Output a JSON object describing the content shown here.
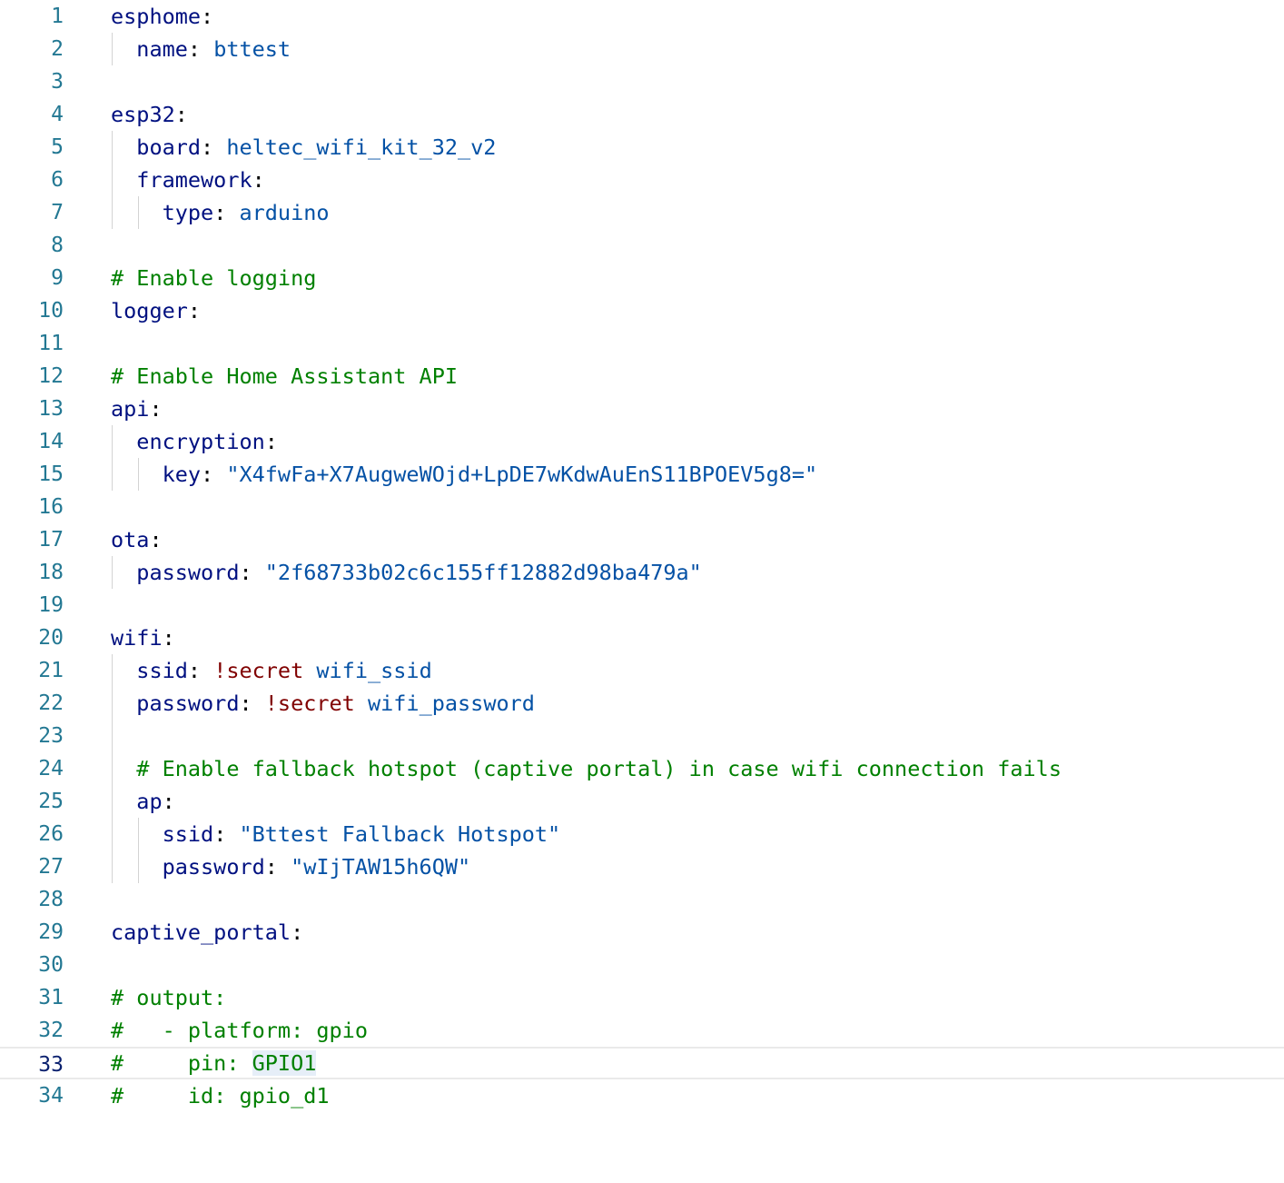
{
  "editor": {
    "current_line": 33,
    "lines": [
      {
        "num": "1",
        "tokens": [
          {
            "t": "esphome",
            "c": "key",
            "n": "yaml-key"
          },
          {
            "t": ":",
            "c": "punct",
            "n": "colon"
          }
        ]
      },
      {
        "num": "2",
        "indent": 1,
        "tokens": [
          {
            "t": "  ",
            "c": "punct",
            "n": "indent"
          },
          {
            "t": "name",
            "c": "key",
            "n": "yaml-key"
          },
          {
            "t": ": ",
            "c": "punct",
            "n": "colon"
          },
          {
            "t": "bttest",
            "c": "val",
            "n": "yaml-value"
          }
        ]
      },
      {
        "num": "3",
        "tokens": []
      },
      {
        "num": "4",
        "tokens": [
          {
            "t": "esp32",
            "c": "key",
            "n": "yaml-key"
          },
          {
            "t": ":",
            "c": "punct",
            "n": "colon"
          }
        ]
      },
      {
        "num": "5",
        "indent": 1,
        "tokens": [
          {
            "t": "  ",
            "c": "punct",
            "n": "indent"
          },
          {
            "t": "board",
            "c": "key",
            "n": "yaml-key"
          },
          {
            "t": ": ",
            "c": "punct",
            "n": "colon"
          },
          {
            "t": "heltec_wifi_kit_32_v2",
            "c": "val",
            "n": "yaml-value"
          }
        ]
      },
      {
        "num": "6",
        "indent": 1,
        "tokens": [
          {
            "t": "  ",
            "c": "punct",
            "n": "indent"
          },
          {
            "t": "framework",
            "c": "key",
            "n": "yaml-key"
          },
          {
            "t": ":",
            "c": "punct",
            "n": "colon"
          }
        ]
      },
      {
        "num": "7",
        "indent": 2,
        "tokens": [
          {
            "t": "    ",
            "c": "punct",
            "n": "indent"
          },
          {
            "t": "type",
            "c": "key",
            "n": "yaml-key"
          },
          {
            "t": ": ",
            "c": "punct",
            "n": "colon"
          },
          {
            "t": "arduino",
            "c": "val",
            "n": "yaml-value"
          }
        ]
      },
      {
        "num": "8",
        "tokens": []
      },
      {
        "num": "9",
        "tokens": [
          {
            "t": "# Enable logging",
            "c": "comment",
            "n": "yaml-comment"
          }
        ]
      },
      {
        "num": "10",
        "tokens": [
          {
            "t": "logger",
            "c": "key",
            "n": "yaml-key"
          },
          {
            "t": ":",
            "c": "punct",
            "n": "colon"
          }
        ]
      },
      {
        "num": "11",
        "tokens": []
      },
      {
        "num": "12",
        "tokens": [
          {
            "t": "# Enable Home Assistant API",
            "c": "comment",
            "n": "yaml-comment"
          }
        ]
      },
      {
        "num": "13",
        "tokens": [
          {
            "t": "api",
            "c": "key",
            "n": "yaml-key"
          },
          {
            "t": ":",
            "c": "punct",
            "n": "colon"
          }
        ]
      },
      {
        "num": "14",
        "indent": 1,
        "tokens": [
          {
            "t": "  ",
            "c": "punct",
            "n": "indent"
          },
          {
            "t": "encryption",
            "c": "key",
            "n": "yaml-key"
          },
          {
            "t": ":",
            "c": "punct",
            "n": "colon"
          }
        ]
      },
      {
        "num": "15",
        "indent": 2,
        "tokens": [
          {
            "t": "    ",
            "c": "punct",
            "n": "indent"
          },
          {
            "t": "key",
            "c": "key",
            "n": "yaml-key"
          },
          {
            "t": ": ",
            "c": "punct",
            "n": "colon"
          },
          {
            "t": "\"X4fwFa+X7AugweWOjd+LpDE7wKdwAuEnS11BPOEV5g8=\"",
            "c": "val",
            "n": "yaml-string"
          }
        ]
      },
      {
        "num": "16",
        "tokens": []
      },
      {
        "num": "17",
        "tokens": [
          {
            "t": "ota",
            "c": "key",
            "n": "yaml-key"
          },
          {
            "t": ":",
            "c": "punct",
            "n": "colon"
          }
        ]
      },
      {
        "num": "18",
        "indent": 1,
        "tokens": [
          {
            "t": "  ",
            "c": "punct",
            "n": "indent"
          },
          {
            "t": "password",
            "c": "key",
            "n": "yaml-key"
          },
          {
            "t": ": ",
            "c": "punct",
            "n": "colon"
          },
          {
            "t": "\"2f68733b02c6c155ff12882d98ba479a\"",
            "c": "val",
            "n": "yaml-string"
          }
        ]
      },
      {
        "num": "19",
        "tokens": []
      },
      {
        "num": "20",
        "tokens": [
          {
            "t": "wifi",
            "c": "key",
            "n": "yaml-key"
          },
          {
            "t": ":",
            "c": "punct",
            "n": "colon"
          }
        ]
      },
      {
        "num": "21",
        "indent": 1,
        "tokens": [
          {
            "t": "  ",
            "c": "punct",
            "n": "indent"
          },
          {
            "t": "ssid",
            "c": "key",
            "n": "yaml-key"
          },
          {
            "t": ": ",
            "c": "punct",
            "n": "colon"
          },
          {
            "t": "!secret",
            "c": "tag",
            "n": "yaml-tag"
          },
          {
            "t": " ",
            "c": "punct",
            "n": "space"
          },
          {
            "t": "wifi_ssid",
            "c": "val",
            "n": "yaml-value"
          }
        ]
      },
      {
        "num": "22",
        "indent": 1,
        "tokens": [
          {
            "t": "  ",
            "c": "punct",
            "n": "indent"
          },
          {
            "t": "password",
            "c": "key",
            "n": "yaml-key"
          },
          {
            "t": ": ",
            "c": "punct",
            "n": "colon"
          },
          {
            "t": "!secret",
            "c": "tag",
            "n": "yaml-tag"
          },
          {
            "t": " ",
            "c": "punct",
            "n": "space"
          },
          {
            "t": "wifi_password",
            "c": "val",
            "n": "yaml-value"
          }
        ]
      },
      {
        "num": "23",
        "indent": 1,
        "tokens": []
      },
      {
        "num": "24",
        "indent": 1,
        "tokens": [
          {
            "t": "  ",
            "c": "punct",
            "n": "indent"
          },
          {
            "t": "# Enable fallback hotspot (captive portal) in case wifi connection fails",
            "c": "comment",
            "n": "yaml-comment"
          }
        ]
      },
      {
        "num": "25",
        "indent": 1,
        "tokens": [
          {
            "t": "  ",
            "c": "punct",
            "n": "indent"
          },
          {
            "t": "ap",
            "c": "key",
            "n": "yaml-key"
          },
          {
            "t": ":",
            "c": "punct",
            "n": "colon"
          }
        ]
      },
      {
        "num": "26",
        "indent": 2,
        "tokens": [
          {
            "t": "    ",
            "c": "punct",
            "n": "indent"
          },
          {
            "t": "ssid",
            "c": "key",
            "n": "yaml-key"
          },
          {
            "t": ": ",
            "c": "punct",
            "n": "colon"
          },
          {
            "t": "\"Bttest Fallback Hotspot\"",
            "c": "val",
            "n": "yaml-string"
          }
        ]
      },
      {
        "num": "27",
        "indent": 2,
        "tokens": [
          {
            "t": "    ",
            "c": "punct",
            "n": "indent"
          },
          {
            "t": "password",
            "c": "key",
            "n": "yaml-key"
          },
          {
            "t": ": ",
            "c": "punct",
            "n": "colon"
          },
          {
            "t": "\"wIjTAW15h6QW\"",
            "c": "val",
            "n": "yaml-string"
          }
        ]
      },
      {
        "num": "28",
        "tokens": []
      },
      {
        "num": "29",
        "tokens": [
          {
            "t": "captive_portal",
            "c": "key",
            "n": "yaml-key"
          },
          {
            "t": ":",
            "c": "punct",
            "n": "colon"
          }
        ]
      },
      {
        "num": "30",
        "tokens": []
      },
      {
        "num": "31",
        "tokens": [
          {
            "t": "# output:",
            "c": "comment",
            "n": "yaml-comment"
          }
        ]
      },
      {
        "num": "32",
        "tokens": [
          {
            "t": "#   - platform: gpio",
            "c": "comment",
            "n": "yaml-comment"
          }
        ]
      },
      {
        "num": "33",
        "tokens": [
          {
            "t": "#     pin: ",
            "c": "comment",
            "n": "yaml-comment"
          },
          {
            "t": "GPIO1",
            "c": "comment hl",
            "n": "selection-highlight"
          }
        ]
      },
      {
        "num": "34",
        "tokens": [
          {
            "t": "#     id: gpio_d1",
            "c": "comment",
            "n": "yaml-comment"
          }
        ]
      }
    ]
  },
  "colors": {
    "line_number": "#237893",
    "line_number_active": "#0b216f",
    "key": "#001080",
    "value": "#0451a5",
    "tag": "#800000",
    "comment": "#008000",
    "guide": "#d3d3d3",
    "current_line_border": "#eaeaea",
    "selection_highlight": "#e6eef8"
  }
}
